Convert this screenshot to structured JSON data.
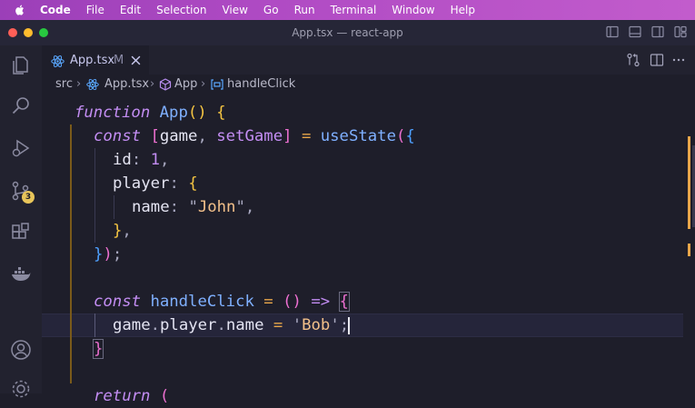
{
  "menubar": {
    "app": "Code",
    "items": [
      "File",
      "Edit",
      "Selection",
      "View",
      "Go",
      "Run",
      "Terminal",
      "Window",
      "Help"
    ]
  },
  "window": {
    "title": "App.tsx — react-app"
  },
  "activity": {
    "scm_badge": "3"
  },
  "tab": {
    "name": "App.tsx",
    "modified": "M"
  },
  "breadcrumb": {
    "folder": "src",
    "file": "App.tsx",
    "component": "App",
    "symbol": "handleClick"
  },
  "colors": {
    "menubar": "#b04bc4",
    "background": "#1e1e2a",
    "keyword": "#c38df3",
    "function": "#7fb0ff",
    "string": "#f3c08a",
    "accent_scm_badge": "#e8c55a"
  },
  "code": {
    "l1": {
      "kw": "function",
      "name": "App",
      "parens": "()",
      "brace": "{"
    },
    "l2": {
      "kw": "const",
      "lb": "[",
      "v1": "game",
      "comma": ",",
      "v2": "setGame",
      "rb": "]",
      "eq": "=",
      "fn": "useState",
      "lp": "(",
      "lc": "{"
    },
    "l3": {
      "key": "id",
      "colon": ":",
      "val": "1",
      "comma": ","
    },
    "l4": {
      "key": "player",
      "colon": ":",
      "brace": "{"
    },
    "l5": {
      "key": "name",
      "colon": ":",
      "q1": "\"",
      "str": "John",
      "q2": "\"",
      "comma": ","
    },
    "l6": {
      "brace": "}",
      "comma": ","
    },
    "l7": {
      "rc": "}",
      "rp": ")",
      "semi": ";"
    },
    "l8": {
      "kw": "const",
      "name": "handleClick",
      "eq": "=",
      "parens": "()",
      "arrow": "=>",
      "brace": "{"
    },
    "l9": {
      "a": "game",
      "dot1": ".",
      "b": "player",
      "dot2": ".",
      "c": "name",
      "eq": "=",
      "q1": "'",
      "str": "Bob",
      "q2": "'",
      "semi": ";"
    },
    "l10": {
      "brace": "}"
    },
    "l11": {
      "kw": "return",
      "paren": "("
    }
  }
}
